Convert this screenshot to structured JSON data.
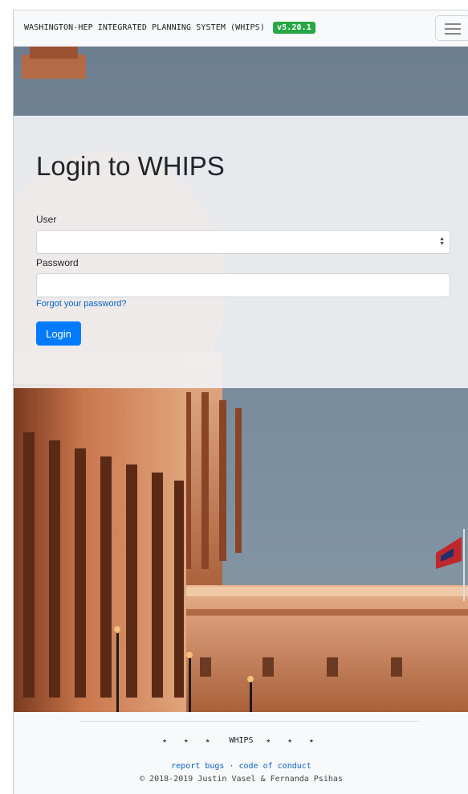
{
  "navbar": {
    "brand": "WASHINGTON-HEP INTEGRATED PLANNING SYSTEM (WHIPS)",
    "version": "v5.20.1",
    "version_color": "#28a745",
    "menu_icon": "hamburger-icon"
  },
  "login": {
    "title": "Login to WHIPS",
    "user_label": "User",
    "user_value": "",
    "password_label": "Password",
    "password_value": "",
    "forgot_link": "Forgot your password?",
    "login_button": "Login",
    "accent_color": "#007bff"
  },
  "footer": {
    "stars_left": "★ ★ ★",
    "brand": "WHIPS",
    "stars_right": "★ ★ ★",
    "report_bugs": "report bugs",
    "separator": "·",
    "code_of_conduct": "code of conduct",
    "copyright": "© 2018-2019 Justin Vasel & Fernanda Psihas"
  }
}
